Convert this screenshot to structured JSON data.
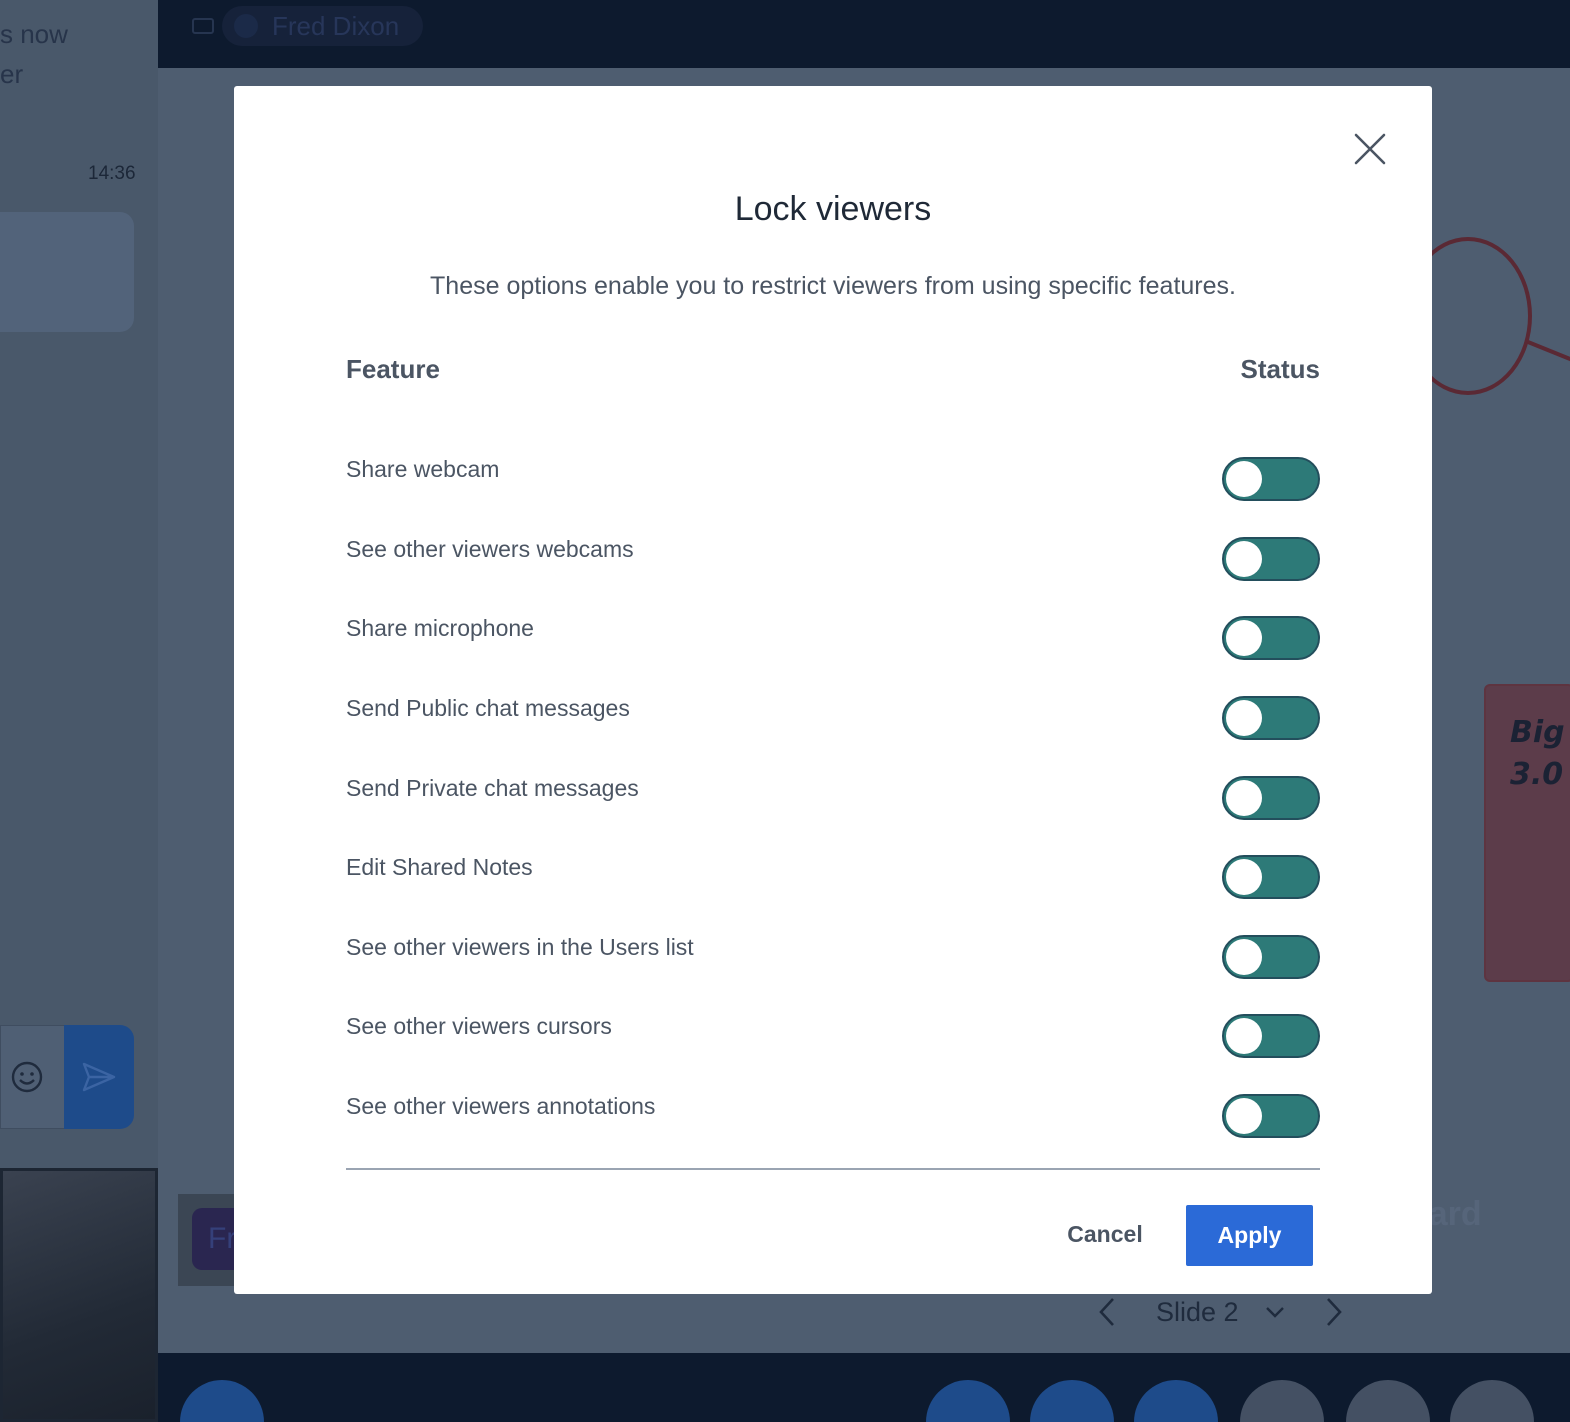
{
  "background": {
    "chat": {
      "message_text": "s now\ner",
      "message_time": "14:36"
    },
    "topbar": {
      "talker_name": "Fred Dixon"
    },
    "note_text": "Big\n3.0",
    "board_label": "oard",
    "presenter_tag": "Fr",
    "slide_label": "Slide 2"
  },
  "modal": {
    "title": "Lock viewers",
    "description": "These options enable you to restrict viewers from using specific features.",
    "column_feature": "Feature",
    "column_status": "Status",
    "features": [
      {
        "label": "Share webcam",
        "locked": true
      },
      {
        "label": "See other viewers webcams",
        "locked": true
      },
      {
        "label": "Share microphone",
        "locked": true
      },
      {
        "label": "Send Public chat messages",
        "locked": true
      },
      {
        "label": "Send Private chat messages",
        "locked": true
      },
      {
        "label": "Edit Shared Notes",
        "locked": true
      },
      {
        "label": "See other viewers in the Users list",
        "locked": true
      },
      {
        "label": "See other viewers cursors",
        "locked": true
      },
      {
        "label": "See other viewers annotations",
        "locked": true
      }
    ],
    "cancel_label": "Cancel",
    "apply_label": "Apply"
  },
  "colors": {
    "toggle_on": "#2d7a78",
    "apply_button": "#2b6ad7",
    "overlay": "#4b5563"
  }
}
